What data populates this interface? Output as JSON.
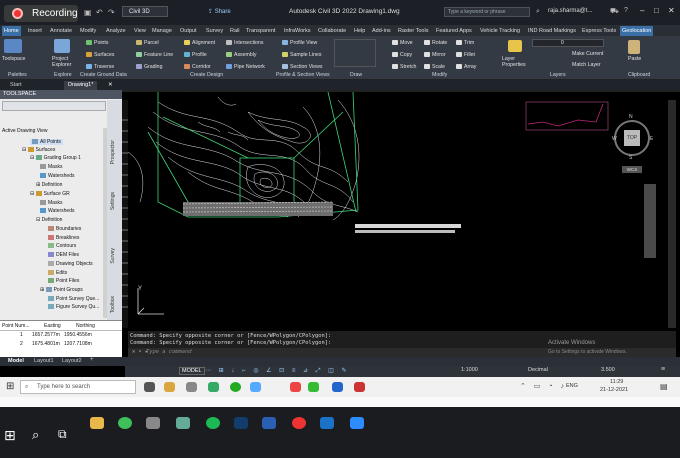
{
  "recording": {
    "label": "Recording"
  },
  "title_bar": {
    "app_title": "Autodesk Civil 3D 2022   Drawing1.dwg",
    "workspace": "Civil 3D",
    "share": "Share",
    "search_placeholder": "Type a keyword or phrase",
    "user": "raja.sharma@t..."
  },
  "ribbon_tabs": [
    "Home",
    "Insert",
    "Annotate",
    "Modify",
    "Analyze",
    "View",
    "Manage",
    "Output",
    "Survey",
    "Rail",
    "Transparent",
    "InfraWorks",
    "Collaborate",
    "Help",
    "Add-ins",
    "Raster Tools",
    "Featured Apps",
    "Vehicle Tracking",
    "IND Road Markings",
    "Express Tools",
    "Geolocation"
  ],
  "ribbon": {
    "toolspace": "Toolspace",
    "project_explorer": "Project Explorer",
    "points": "Points",
    "surfaces": "Surfaces",
    "traverse": "Traverse",
    "parcel": "Parcel",
    "feature_line": "Feature Line",
    "grading": "Grading",
    "alignment": "Alignment",
    "profile": "Profile",
    "corridor": "Corridor",
    "intersections": "Intersections",
    "assembly": "Assembly",
    "pipe_network": "Pipe Network",
    "profile_view": "Profile View",
    "sample_lines": "Sample Lines",
    "section_views": "Section Views",
    "move": "Move",
    "rotate": "Rotate",
    "trim": "Trim",
    "copy": "Copy",
    "mirror": "Mirror",
    "fillet": "Fillet",
    "stretch": "Stretch",
    "scale": "Scale",
    "array": "Array",
    "layer_properties": "Layer Properties",
    "make_current": "Make Current",
    "match_layer": "Match Layer",
    "layer_value": "0",
    "paste": "Paste",
    "panels": {
      "palettes": "Palettes",
      "explore": "Explore",
      "create_ground_data": "Create Ground Data",
      "create_design": "Create Design",
      "profile_section": "Profile & Section Views",
      "draw": "Draw",
      "modify": "Modify",
      "layers": "Layers",
      "clipboard": "Clipboard"
    }
  },
  "doc_tabs": [
    "Start",
    "Drawing1*"
  ],
  "toolspace": {
    "header": "TOOLSPACE",
    "active_view": "Active Drawing View",
    "tree": [
      "All Points",
      "Surfaces",
      "Grading Group 1",
      "Masks",
      "Watersheds",
      "Definition",
      "Surface GR",
      "Masks",
      "Watersheds",
      "Definition",
      "Boundaries",
      "Breaklines",
      "Contours",
      "DEM Files",
      "Drawing Objects",
      "Edits",
      "Point Files",
      "Point Groups",
      "Point Survey Que...",
      "Figure Survey Qu..."
    ],
    "side_tabs": [
      "Prospector",
      "Settings",
      "Survey",
      "Toolbox"
    ]
  },
  "point_table": {
    "columns": [
      "Point Num...",
      "Easting",
      "Northing"
    ],
    "rows": [
      [
        "1",
        "1657.2577m",
        "1950.4556m"
      ],
      [
        "2",
        "1675.4801m",
        "1207.7108m"
      ]
    ]
  },
  "viewcube": {
    "face": "TOP",
    "n": "N",
    "w": "W",
    "e": "E",
    "s": "S",
    "wcs": "WCS"
  },
  "command_history": [
    "Command: Specify opposite corner or [Fence/WPolygon/CPolygon]:",
    "Command: Specify opposite corner or [Fence/WPolygon/CPolygon]:"
  ],
  "command_placeholder": "Type a command",
  "watermark": {
    "line1": "Activate Windows",
    "line2": "Go to Settings to activate Windows."
  },
  "layout_tabs": [
    "Model",
    "Layout1",
    "Layout2"
  ],
  "status": {
    "model": "MODEL",
    "scale": "1:1000",
    "units": "Decimal",
    "value": "3.500"
  },
  "tray": {
    "lang": "ENG",
    "time": "11:29",
    "date": "21-12-2021"
  },
  "taskbar_search": "Type here to search"
}
